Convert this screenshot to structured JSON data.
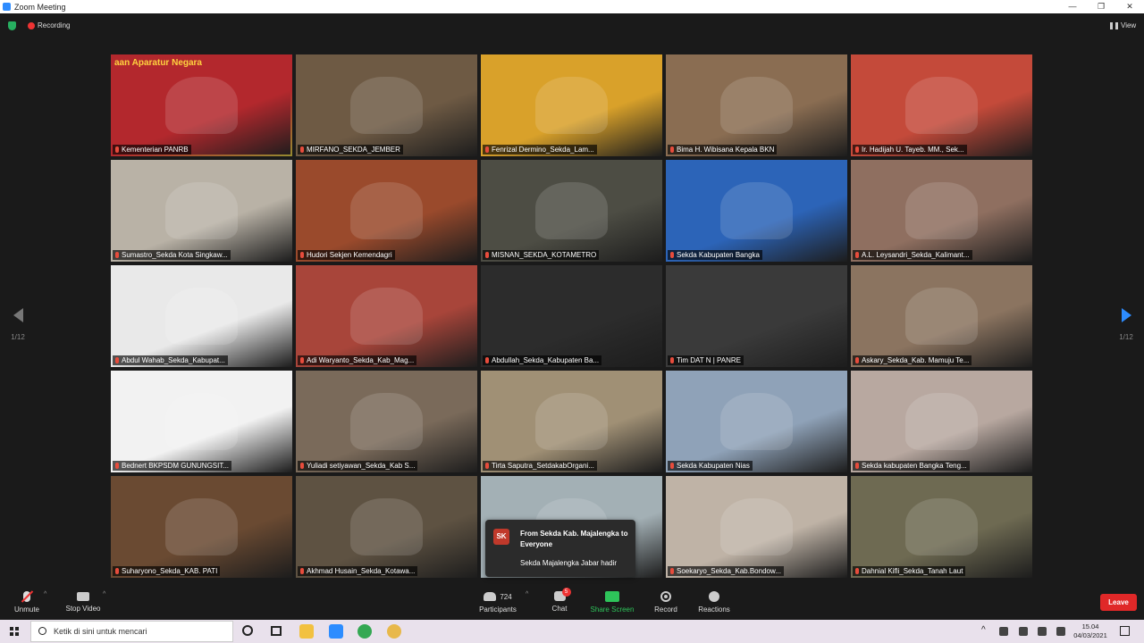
{
  "window": {
    "title": "Zoom Meeting",
    "minimize": "—",
    "maximize": "❐",
    "close": "✕"
  },
  "topbar": {
    "recording_label": "Recording",
    "view_label": "View"
  },
  "pagination": {
    "left_page": "1/12",
    "right_page": "1/12"
  },
  "participants": [
    {
      "name": "Kementerian PANRB",
      "overlay": "aan Aparatur Negara",
      "active": true,
      "color": "#b3282d"
    },
    {
      "name": "MIRFANO_SEKDA_JEMBER",
      "color": "#6e5a44"
    },
    {
      "name": "Fenrizal Dermino_Sekda_Lam...",
      "color": "#d9a12a"
    },
    {
      "name": "Bima H. Wibisana Kepala BKN",
      "color": "#8a6d52"
    },
    {
      "name": "Ir. Hadijah U. Tayeb. MM., Sek...",
      "color": "#c44a3a"
    },
    {
      "name": "Sumastro_Sekda Kota Singkaw...",
      "color": "#b9b2a6"
    },
    {
      "name": "Hudori Sekjen Kemendagri",
      "color": "#9a4a2c"
    },
    {
      "name": "MISNAN_SEKDA_KOTAMETRO",
      "color": "#4d4d44"
    },
    {
      "name": "Sekda Kabupaten Bangka",
      "color": "#2c64b8"
    },
    {
      "name": "A.L. Leysandri_Sekda_Kalimant...",
      "color": "#8f6f60"
    },
    {
      "name": "Abdul Wahab_Sekda_Kabupat...",
      "color": "#e9e9e9"
    },
    {
      "name": "Adi Waryanto_Sekda_Kab_Mag...",
      "color": "#a8453a"
    },
    {
      "name": "Abdullah_Sekda_Kabupaten Ba...",
      "color": "#2c2c2c"
    },
    {
      "name": "Tim DAT N | PANRE",
      "color": "#3a3a3a"
    },
    {
      "name": "Askary_Sekda_Kab. Mamuju Te...",
      "color": "#8b7460"
    },
    {
      "name": "Bednert BKPSDM GUNUNGSIT...",
      "color": "#f2f2f2"
    },
    {
      "name": "Yuliadi setiyawan_Sekda_Kab S...",
      "color": "#7a6a5a"
    },
    {
      "name": "Tirta Saputra_SetdakabOrgani...",
      "color": "#a09075"
    },
    {
      "name": "Sekda Kabupaten Nias",
      "color": "#8fa2b8"
    },
    {
      "name": "Sekda kabupaten Bangka Teng...",
      "color": "#b8a8a0"
    },
    {
      "name": "Suharyono_Sekda_KAB. PATI",
      "color": "#6a4a32"
    },
    {
      "name": "Akhmad Husain_Sekda_Kotawa...",
      "color": "#5e5242"
    },
    {
      "name": "",
      "color": "#a3b0b5"
    },
    {
      "name": "Soekaryo_Sekda_Kab.Bondow...",
      "color": "#bfb3a6"
    },
    {
      "name": "Dahnial Kifli_Sekda_Tanah Laut",
      "color": "#6e6a52"
    }
  ],
  "chat_popup": {
    "initials": "SK",
    "from": "From Sekda Kab. Majalengka to Everyone",
    "message": "Sekda Majalengka Jabar hadir"
  },
  "toolbar": {
    "unmute": "Unmute",
    "stop_video": "Stop Video",
    "participants_count": "724",
    "participants": "Participants",
    "chat": "Chat",
    "chat_badge": "5",
    "share_screen": "Share Screen",
    "record": "Record",
    "reactions": "Reactions",
    "leave": "Leave",
    "caret": "^"
  },
  "taskbar": {
    "search_placeholder": "Ketik di sini untuk mencari",
    "time": "15.04",
    "date": "04/03/2021",
    "tray_up": "^"
  }
}
